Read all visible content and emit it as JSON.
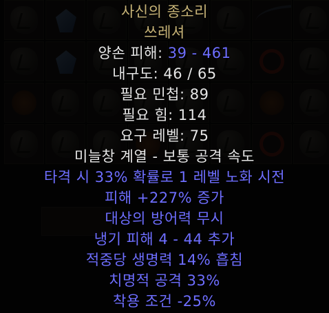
{
  "item": {
    "name": "사신의 종소리",
    "base_type": "쓰레셔",
    "damage_label": "양손 피해: ",
    "damage_value": "39 - 461",
    "durability": "내구도: 46 / 65",
    "req_dex": "필요 민첩: 89",
    "req_str": "필요 힘: 114",
    "req_level": "요구 레벨: 75",
    "attack_speed": "미늘창 계열 - 보통 공격 속도",
    "properties": [
      "타격 시 33% 확률로 1 레벨 노화 시전",
      "피해 +227% 증가",
      "대상의 방어력 무시",
      "냉기 피해 4 - 44 추가",
      "적중당 생명력 14% 흡침",
      "치명적 공격 33%",
      "착용 조건 -25%"
    ]
  },
  "colors": {
    "unique_gold": "#c7b377",
    "magic_blue": "#6e6eff",
    "normal_white": "#e6e6e6"
  },
  "inventory_icons": [
    "rune",
    "gem",
    "amulet",
    "red-coil",
    "pitchfork",
    "chest"
  ]
}
